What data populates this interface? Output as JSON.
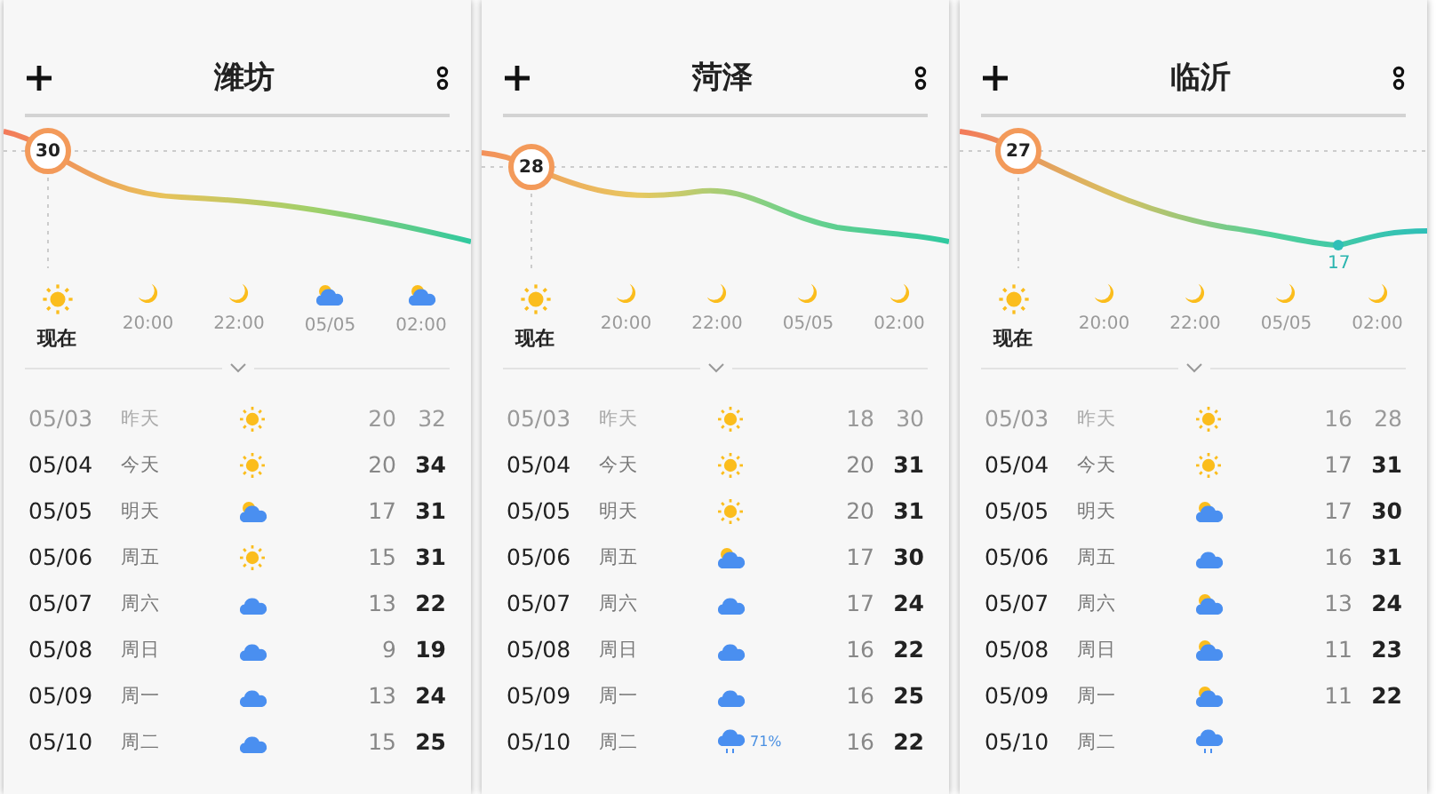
{
  "panels": [
    {
      "city": "潍坊",
      "current_temp": "30",
      "hourly": [
        {
          "kind": "sun",
          "label": "现在",
          "current": true
        },
        {
          "kind": "moon",
          "label": "20:00",
          "current": false
        },
        {
          "kind": "moon",
          "label": "22:00",
          "current": false
        },
        {
          "kind": "partly_cloudy",
          "label": "05/05",
          "current": false
        },
        {
          "kind": "partly_cloudy",
          "label": "02:00",
          "current": false
        }
      ],
      "days": [
        {
          "date": "05/03",
          "day": "昨天",
          "kind": "sun",
          "low": "20",
          "high": "32",
          "past": true
        },
        {
          "date": "05/04",
          "day": "今天",
          "kind": "sun",
          "low": "20",
          "high": "34",
          "past": false
        },
        {
          "date": "05/05",
          "day": "明天",
          "kind": "partly_cloudy",
          "low": "17",
          "high": "31",
          "past": false
        },
        {
          "date": "05/06",
          "day": "周五",
          "kind": "sun",
          "low": "15",
          "high": "31",
          "past": false
        },
        {
          "date": "05/07",
          "day": "周六",
          "kind": "cloud",
          "low": "13",
          "high": "22",
          "past": false
        },
        {
          "date": "05/08",
          "day": "周日",
          "kind": "cloud",
          "low": "9",
          "high": "19",
          "past": false
        },
        {
          "date": "05/09",
          "day": "周一",
          "kind": "cloud",
          "low": "13",
          "high": "24",
          "past": false
        },
        {
          "date": "05/10",
          "day": "周二",
          "kind": "cloud",
          "low": "15",
          "high": "25",
          "past": false
        }
      ]
    },
    {
      "city": "菏泽",
      "current_temp": "28",
      "hourly": [
        {
          "kind": "sun",
          "label": "现在",
          "current": true
        },
        {
          "kind": "moon",
          "label": "20:00",
          "current": false
        },
        {
          "kind": "moon",
          "label": "22:00",
          "current": false
        },
        {
          "kind": "moon",
          "label": "05/05",
          "current": false
        },
        {
          "kind": "moon",
          "label": "02:00",
          "current": false
        }
      ],
      "days": [
        {
          "date": "05/03",
          "day": "昨天",
          "kind": "sun",
          "low": "18",
          "high": "30",
          "past": true
        },
        {
          "date": "05/04",
          "day": "今天",
          "kind": "sun",
          "low": "20",
          "high": "31",
          "past": false
        },
        {
          "date": "05/05",
          "day": "明天",
          "kind": "sun",
          "low": "20",
          "high": "31",
          "past": false
        },
        {
          "date": "05/06",
          "day": "周五",
          "kind": "partly_cloudy",
          "low": "17",
          "high": "30",
          "past": false
        },
        {
          "date": "05/07",
          "day": "周六",
          "kind": "cloud",
          "low": "17",
          "high": "24",
          "past": false
        },
        {
          "date": "05/08",
          "day": "周日",
          "kind": "cloud",
          "low": "16",
          "high": "22",
          "past": false
        },
        {
          "date": "05/09",
          "day": "周一",
          "kind": "cloud",
          "low": "16",
          "high": "25",
          "past": false
        },
        {
          "date": "05/10",
          "day": "周二",
          "kind": "rain",
          "precip": "71%",
          "low": "16",
          "high": "22",
          "past": false
        }
      ]
    },
    {
      "city": "临沂",
      "current_temp": "27",
      "min_temp": "17",
      "hourly": [
        {
          "kind": "sun",
          "label": "现在",
          "current": true
        },
        {
          "kind": "moon",
          "label": "20:00",
          "current": false
        },
        {
          "kind": "moon",
          "label": "22:00",
          "current": false
        },
        {
          "kind": "moon",
          "label": "05/05",
          "current": false
        },
        {
          "kind": "moon",
          "label": "02:00",
          "current": false
        }
      ],
      "days": [
        {
          "date": "05/03",
          "day": "昨天",
          "kind": "sun",
          "low": "16",
          "high": "28",
          "past": true
        },
        {
          "date": "05/04",
          "day": "今天",
          "kind": "sun",
          "low": "17",
          "high": "31",
          "past": false
        },
        {
          "date": "05/05",
          "day": "明天",
          "kind": "partly_cloudy",
          "low": "17",
          "high": "30",
          "past": false
        },
        {
          "date": "05/06",
          "day": "周五",
          "kind": "cloud",
          "low": "16",
          "high": "31",
          "past": false
        },
        {
          "date": "05/07",
          "day": "周六",
          "kind": "partly_cloudy",
          "low": "13",
          "high": "24",
          "past": false
        },
        {
          "date": "05/08",
          "day": "周日",
          "kind": "partly_cloudy",
          "low": "11",
          "high": "23",
          "past": false
        },
        {
          "date": "05/09",
          "day": "周一",
          "kind": "partly_cloudy",
          "low": "11",
          "high": "22",
          "past": false
        },
        {
          "date": "05/10",
          "day": "周二",
          "kind": "rain",
          "past": false
        }
      ]
    }
  ]
}
